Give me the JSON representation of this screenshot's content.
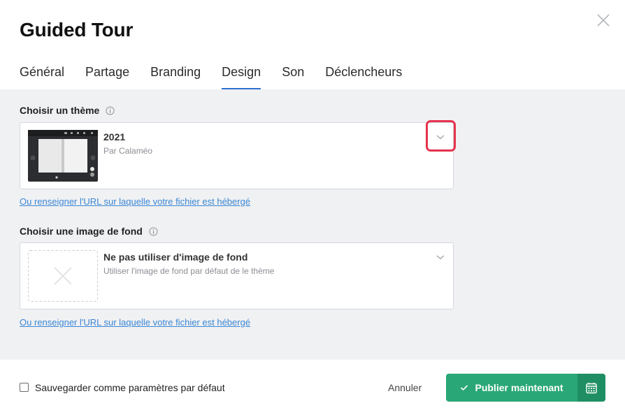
{
  "dialog": {
    "title": "Guided Tour"
  },
  "tabs": [
    {
      "label": "Général"
    },
    {
      "label": "Partage"
    },
    {
      "label": "Branding"
    },
    {
      "label": "Design",
      "active": true
    },
    {
      "label": "Son"
    },
    {
      "label": "Déclencheurs"
    }
  ],
  "theme": {
    "label": "Choisir un thème",
    "selected_title": "2021",
    "selected_subtitle": "Par Calaméo",
    "url_link": "Ou renseigner l'URL sur laquelle votre fichier est hébergé"
  },
  "background": {
    "label": "Choisir une image de fond",
    "selected_title": "Ne pas utiliser d'image de fond",
    "selected_subtitle": "Utiliser l'image de fond par défaut de le thème",
    "url_link": "Ou renseigner l'URL sur laquelle votre fichier est hébergé"
  },
  "footer": {
    "save_default_label": "Sauvegarder comme paramètres par défaut",
    "save_default_checked": false,
    "cancel_label": "Annuler",
    "publish_label": "Publier maintenant"
  },
  "colors": {
    "accent_tab": "#2f6fd1",
    "publish_green": "#2aa776",
    "publish_green_dark": "#1f8f63",
    "highlight_red": "#e5334d",
    "link_blue": "#3a86d4"
  },
  "icons": [
    "close-icon",
    "info-icon",
    "chevron-down-icon",
    "check-icon",
    "calendar-icon"
  ]
}
